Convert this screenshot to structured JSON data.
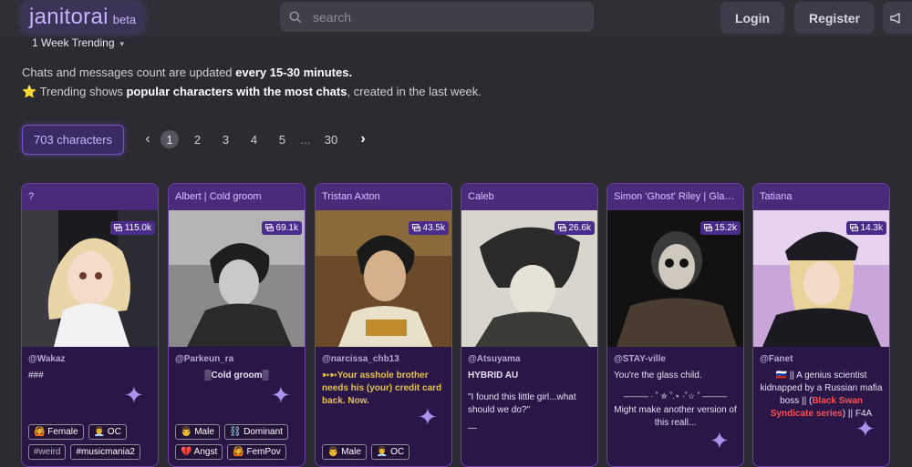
{
  "header": {
    "logo_text": "janitorai",
    "logo_badge": "beta",
    "search_placeholder": "search",
    "login_label": "Login",
    "register_label": "Register"
  },
  "sort_selector": {
    "label": "1 Week Trending"
  },
  "info": {
    "line1_prefix": "Chats and messages count are updated ",
    "line1_bold": "every 15-30 minutes.",
    "line2_icon": "⭐",
    "line2_prefix": " Trending shows ",
    "line2_bold": "popular characters with the most chats",
    "line2_suffix": ", created in the last week."
  },
  "character_count": "703 characters",
  "pagination": {
    "pages": [
      "1",
      "2",
      "3",
      "4",
      "5"
    ],
    "ellipsis": "...",
    "last": "30",
    "current": "1"
  },
  "colors": {
    "accent": "#7a54d6",
    "card_bg": "#2a1748",
    "card_header": "#4a2b7a"
  },
  "cards": [
    {
      "title": "?",
      "chats": "115.0k",
      "creator": "@Wakaz",
      "desc": "###",
      "tags": [
        "🙆 Female",
        "👨‍💼 OC",
        "#weird",
        "#musicmania2"
      ]
    },
    {
      "title": "Albert | Cold groom",
      "chats": "69.1k",
      "creator": "@Parkeun_ra",
      "desc": "▒Cold groom▒",
      "tags": [
        "👨 Male",
        "⛓️ Dominant",
        "💔 Angst",
        "🙆 FemPov"
      ]
    },
    {
      "title": "Tristan Axton",
      "chats": "43.5k",
      "creator": "@narcissa_chb13",
      "desc": "➳➳Your asshole brother needs his (your) credit card back. Now.",
      "tags": [
        "👨 Male",
        "👨‍💼 OC"
      ]
    },
    {
      "title": "Caleb",
      "chats": "26.6k",
      "creator": "@Atsuyama",
      "desc_title": "HYBRID AU",
      "desc": "\"I found this little girl...what should we do?\"",
      "desc_extra": "—",
      "tags": []
    },
    {
      "title": "Simon 'Ghost' Riley | Glas...",
      "chats": "15.2k",
      "creator": "@STAY-ville",
      "desc": "You're the glass child.",
      "desc_divider": "——— · ˚ ✮ ˚.⋆ ·˚☆ ˚ ———",
      "desc_extra": "Might make another version of this reall...",
      "tags": []
    },
    {
      "title": "Tatiana",
      "chats": "14.3k",
      "creator": "@Fanet",
      "desc_prefix": "🇷🇺 || A genius scientist kidnapped by a Russian mafia boss || (",
      "desc_highlight": "Black Swan Syndicate series",
      "desc_suffix": ") || F4A",
      "tags": []
    }
  ]
}
